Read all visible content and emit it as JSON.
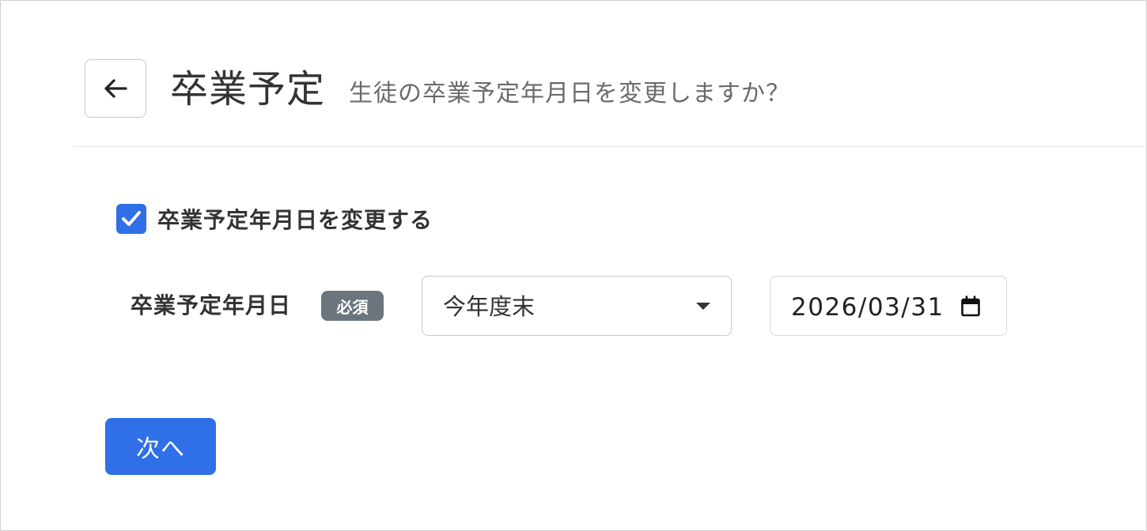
{
  "header": {
    "title": "卒業予定",
    "subtitle": "生徒の卒業予定年月日を変更しますか？"
  },
  "icons": {
    "back": "arrow-left-icon",
    "check": "checkmark-icon",
    "caret": "caret-down-icon",
    "calendar": "calendar-icon"
  },
  "form": {
    "change_checkbox": {
      "label": "卒業予定年月日を変更する",
      "checked": true
    },
    "graduation_date": {
      "label": "卒業予定年月日",
      "required_badge": "必須",
      "select_value": "今年度末",
      "date_value": "2026/03/31"
    }
  },
  "actions": {
    "next_label": "次へ"
  },
  "colors": {
    "primary": "#2f6fe8",
    "badge": "#6c757d",
    "text": "#333333",
    "muted": "#6b6b6b"
  }
}
